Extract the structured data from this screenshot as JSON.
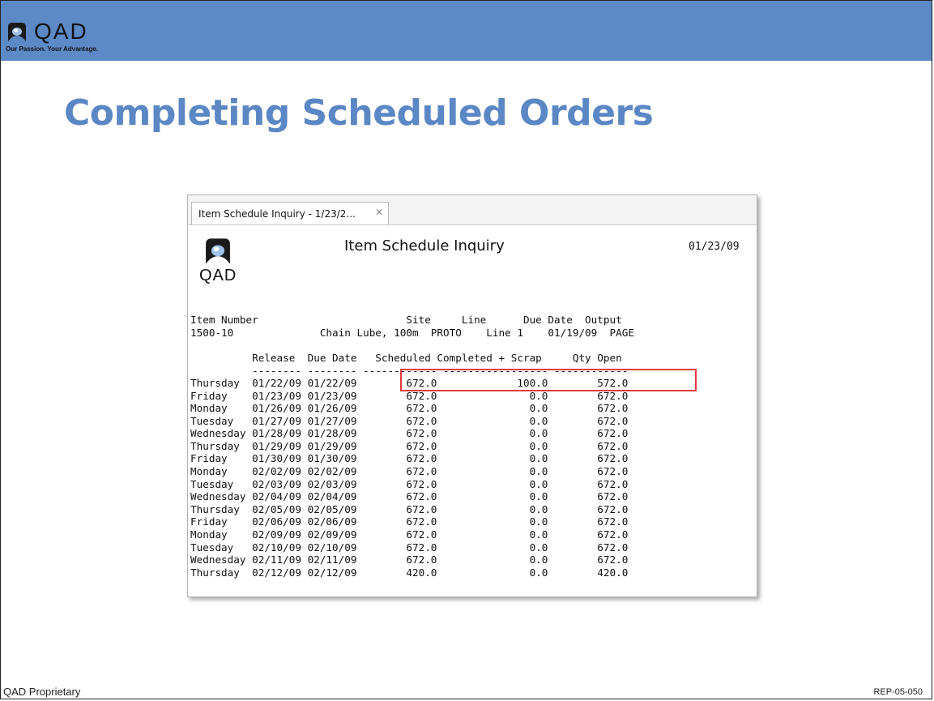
{
  "slide": {
    "logo_text": "QAD",
    "logo_tagline": "Our Passion. Your Advantage.",
    "title": "Completing Scheduled Orders",
    "footer_left": "QAD Proprietary",
    "footer_right": "REP-05-050"
  },
  "colors": {
    "banner": "#5b8ac6",
    "title": "#5b87c5",
    "highlight": "#e03b3b"
  },
  "window": {
    "tab_label": "Item Schedule Inquiry - 1/23/2...",
    "tab_close_icon": "close-icon"
  },
  "report": {
    "logo_text": "QAD",
    "title": "Item Schedule Inquiry",
    "date": "01/23/09",
    "header_labels": "Item Number                        Site     Line      Due Date  Output",
    "header_values": "1500-10              Chain Lube, 100m  PROTO    Line 1    01/19/09  PAGE",
    "column_headers": "          Release  Due Date   Scheduled Completed + Scrap     Qty Open",
    "separator": "          -------- -------- ------------ ----------------- ------------",
    "rows": [
      "Thursday  01/22/09 01/22/09        672.0             100.0        572.0",
      "Friday    01/23/09 01/23/09        672.0               0.0        672.0",
      "Monday    01/26/09 01/26/09        672.0               0.0        672.0",
      "Tuesday   01/27/09 01/27/09        672.0               0.0        672.0",
      "Wednesday 01/28/09 01/28/09        672.0               0.0        672.0",
      "Thursday  01/29/09 01/29/09        672.0               0.0        672.0",
      "Friday    01/30/09 01/30/09        672.0               0.0        672.0",
      "Monday    02/02/09 02/02/09        672.0               0.0        672.0",
      "Tuesday   02/03/09 02/03/09        672.0               0.0        672.0",
      "Wednesday 02/04/09 02/04/09        672.0               0.0        672.0",
      "Thursday  02/05/09 02/05/09        672.0               0.0        672.0",
      "Friday    02/06/09 02/06/09        672.0               0.0        672.0",
      "Monday    02/09/09 02/09/09        672.0               0.0        672.0",
      "Tuesday   02/10/09 02/10/09        672.0               0.0        672.0",
      "Wednesday 02/11/09 02/11/09        672.0               0.0        672.0",
      "Thursday  02/12/09 02/12/09        420.0               0.0        420.0"
    ]
  }
}
